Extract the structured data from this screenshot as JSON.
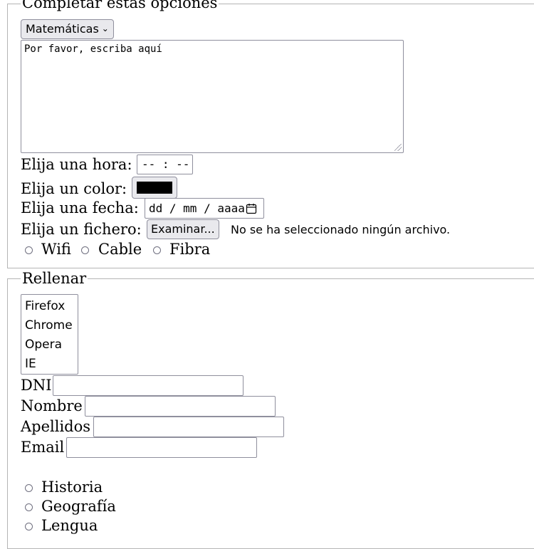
{
  "section1": {
    "legend": "Completar estas opciones",
    "subject_select": {
      "selected": "Matemáticas"
    },
    "textarea": {
      "value": "Por favor, escriba aquí"
    },
    "time": {
      "label": "Elija una hora:",
      "value": "-- : --"
    },
    "color": {
      "label": "Elija un color:",
      "value": "#000000"
    },
    "date": {
      "label": "Elija una fecha:",
      "value": "dd / mm / aaaa"
    },
    "file": {
      "label": "Elija un fichero:",
      "button": "Examinar...",
      "status": "No se ha seleccionado ningún archivo."
    },
    "connection_options": [
      "Wifi",
      "Cable",
      "Fibra"
    ]
  },
  "section2": {
    "legend": "Rellenar",
    "browsers": [
      "Firefox",
      "Chrome",
      "Opera",
      "IE"
    ],
    "fields": {
      "dni": "DNI",
      "nombre": "Nombre",
      "apellidos": "Apellidos",
      "email": "Email"
    },
    "subject_options": [
      "Historia",
      "Geografía",
      "Lengua"
    ]
  },
  "icons": {
    "select_arrow": "chevron-down-icon",
    "date_picker": "calendar-icon"
  }
}
